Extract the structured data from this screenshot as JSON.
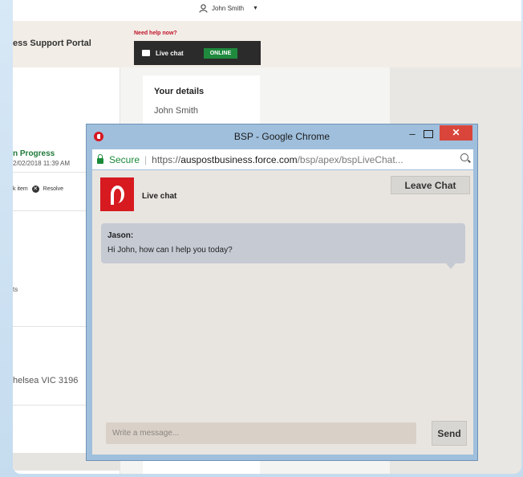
{
  "portal": {
    "user_name": "John Smith",
    "user_menu_caret": "▼",
    "title": "ess Support Portal",
    "need_help": "Need help now?",
    "livechat_label": "Live chat",
    "livechat_status": "ONLINE",
    "details_title": "Your details",
    "details_name": "John Smith",
    "case_status": "n Progress",
    "case_date": "2/02/2018 11:39 AM",
    "action_track": "k item",
    "action_resolve": "Resolve",
    "truncated_text": "ts",
    "address": "helsea VIC 3196"
  },
  "popup": {
    "window_title": "BSP - Google Chrome",
    "minimize_glyph": "–",
    "close_glyph": "✕",
    "secure_label": "Secure",
    "separator": "|",
    "url_scheme": "https://",
    "url_host": "auspostbusiness.force.com",
    "url_path": "/bsp/apex/bspLiveChat...",
    "chat_title": "Live chat",
    "leave_chat_label": "Leave Chat",
    "messages": [
      {
        "sender": "Jason:",
        "text": "Hi John, how can I help you today?"
      }
    ],
    "input_placeholder": "Write a message...",
    "send_label": "Send"
  },
  "colors": {
    "brand_red": "#d71920",
    "online_green": "#1f8a3e",
    "secure_green": "#1a8a3a",
    "close_red": "#d9453a"
  }
}
